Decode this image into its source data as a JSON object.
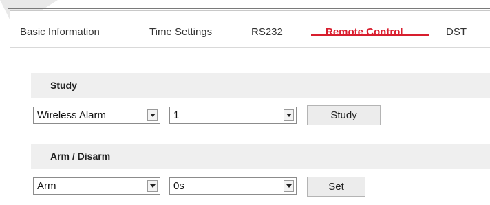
{
  "tabs": [
    {
      "label": "Basic Information",
      "active": false
    },
    {
      "label": "Time Settings",
      "active": false
    },
    {
      "label": "RS232",
      "active": false
    },
    {
      "label": "Remote Control",
      "active": true
    },
    {
      "label": "DST",
      "active": false
    }
  ],
  "study": {
    "title": "Study",
    "type_select": {
      "value": "Wireless Alarm"
    },
    "number_select": {
      "value": "1"
    },
    "button_label": "Study"
  },
  "arm_disarm": {
    "title": "Arm / Disarm",
    "mode_select": {
      "value": "Arm"
    },
    "delay_select": {
      "value": "0s"
    },
    "button_label": "Set"
  },
  "colors": {
    "accent": "#d81e2e",
    "section_bg": "#efefef"
  }
}
